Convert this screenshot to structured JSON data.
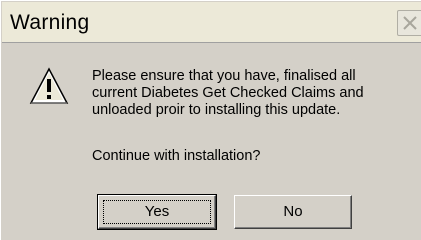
{
  "dialog": {
    "title": "Warning",
    "close_icon": "close-icon",
    "icon": "warning-icon",
    "message_lines": [
      "Please ensure that you have, finalised all",
      "current Diabetes Get Checked Claims and",
      "unloaded proir to installing this update."
    ],
    "prompt": "Continue with installation?",
    "buttons": {
      "yes": "Yes",
      "no": "No"
    }
  },
  "colors": {
    "background": "#d4d0c8",
    "titlebar": "#ece9d8",
    "text": "#000000"
  }
}
